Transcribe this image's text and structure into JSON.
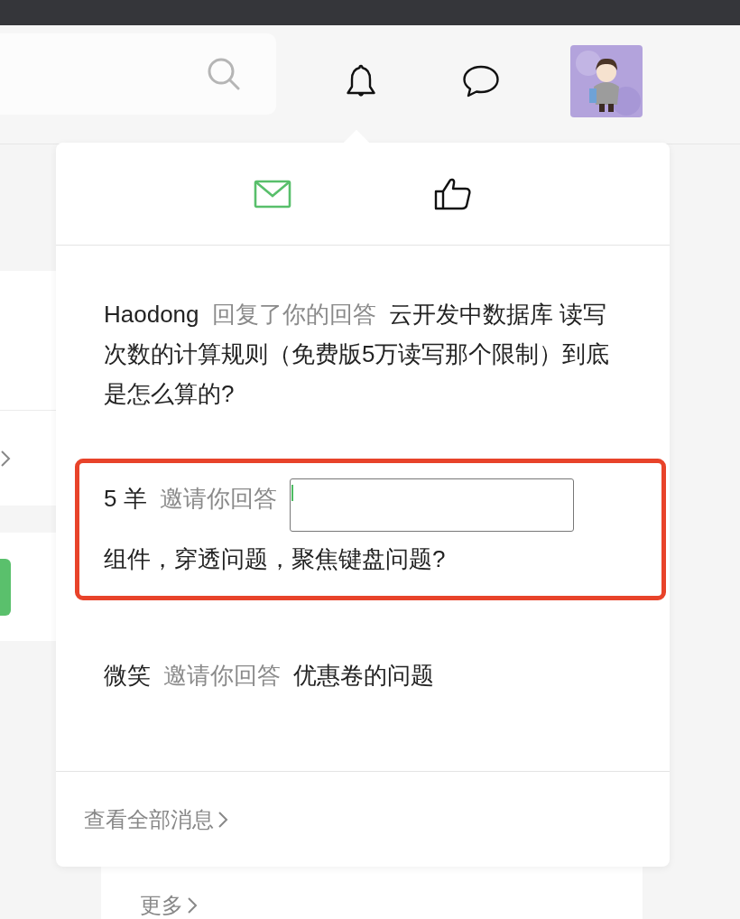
{
  "notifications_popup": {
    "tabs": [
      {
        "kind": "mail",
        "selected": true
      },
      {
        "kind": "like",
        "selected": false
      }
    ],
    "messages": [
      {
        "kind": "plain",
        "highlighted": false,
        "user": "Haodong",
        "action": "回复了你的回答",
        "title": "云开发中数据库 读写次数的计算规则（免费版5万读写那个限制）到底是怎么算的?"
      },
      {
        "kind": "field",
        "highlighted": true,
        "user": "5 羊",
        "action": "邀请你回答",
        "title": "组件，穿透问题，聚焦键盘问题?"
      },
      {
        "kind": "plain",
        "highlighted": false,
        "user": "微笑",
        "action": "邀请你回答",
        "title": "优惠卷的问题"
      }
    ],
    "footer_link": "查看全部消息"
  },
  "more_link": "更多"
}
